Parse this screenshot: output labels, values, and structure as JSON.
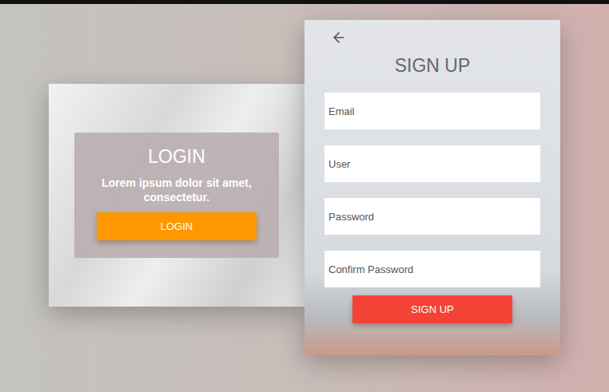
{
  "login": {
    "title": "LOGIN",
    "text": "Lorem ipsum dolor sit amet, consectetur.",
    "button": "LOGIN"
  },
  "signup": {
    "title": "SIGN UP",
    "fields": [
      {
        "placeholder": "Email"
      },
      {
        "placeholder": "User"
      },
      {
        "placeholder": "Password"
      },
      {
        "placeholder": "Confirm Password"
      }
    ],
    "button": "SIGN UP"
  }
}
